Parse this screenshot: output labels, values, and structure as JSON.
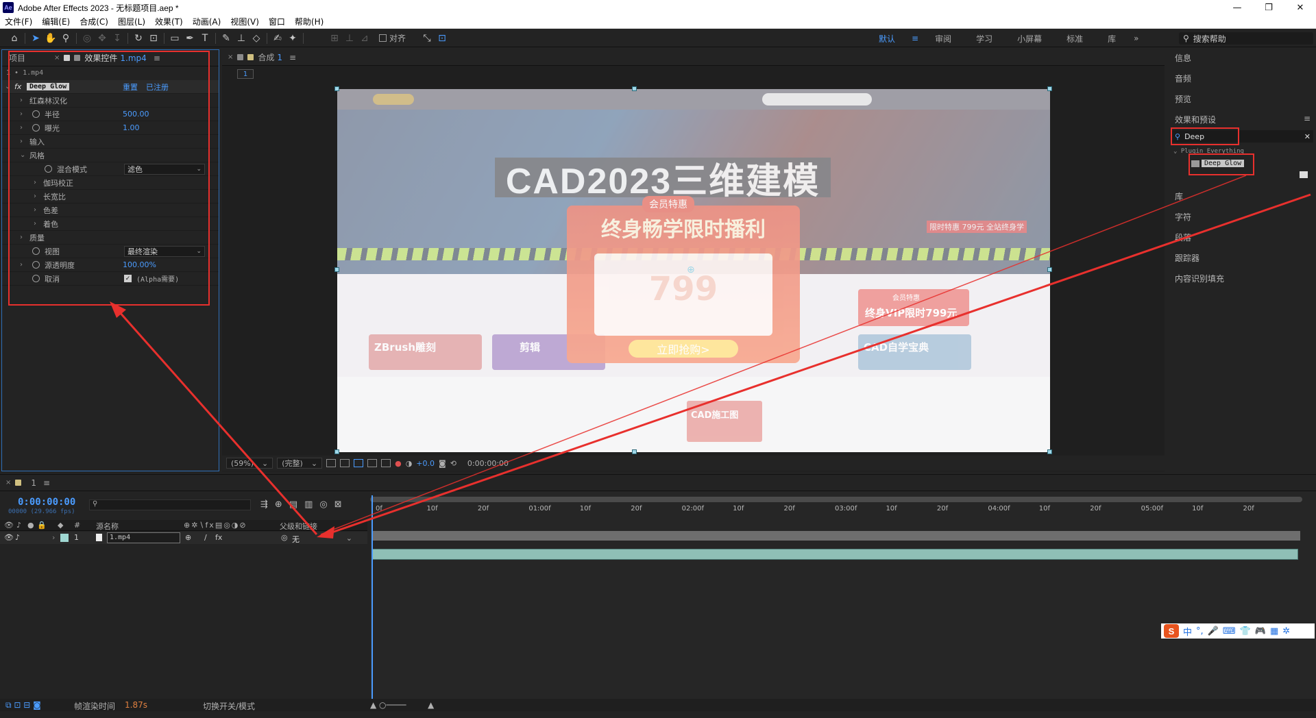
{
  "window": {
    "title": "Adobe After Effects 2023 - 无标题项目.aep *",
    "logo": "Ae",
    "controls": [
      "—",
      "❐",
      "✕"
    ]
  },
  "menu": [
    "文件(F)",
    "编辑(E)",
    "合成(C)",
    "图层(L)",
    "效果(T)",
    "动画(A)",
    "视图(V)",
    "窗口",
    "帮助(H)"
  ],
  "toolbar": {
    "snap_label": "对齐",
    "workspaces": [
      "默认",
      "审阅",
      "学习",
      "小屏幕",
      "标准",
      "库"
    ],
    "active_workspace": "默认",
    "more": "»",
    "search_help": "搜索帮助"
  },
  "project_panel": {
    "tab_project": "项目",
    "tab_effects": "效果控件",
    "tab_effects_file": "1.mp4",
    "breadcrumb": "1 • 1.mp4"
  },
  "effect": {
    "fx_symbol": "fx",
    "name": "Deep Glow",
    "reset": "重置",
    "registered": "已注册",
    "rows": [
      {
        "label": "红森林汉化",
        "kind": "twirl"
      },
      {
        "label": "半径",
        "kind": "stopwatch",
        "value": "500.00"
      },
      {
        "label": "曝光",
        "kind": "stopwatch",
        "value": "1.00"
      },
      {
        "label": "输入",
        "kind": "twirl"
      },
      {
        "label": "风格",
        "kind": "open"
      },
      {
        "label": "混合模式",
        "kind": "dropdown",
        "value": "滤色"
      },
      {
        "label": "伽玛校正",
        "kind": "sub"
      },
      {
        "label": "长宽比",
        "kind": "sub"
      },
      {
        "label": "色差",
        "kind": "sub"
      },
      {
        "label": "着色",
        "kind": "sub"
      },
      {
        "label": "质量",
        "kind": "twirl"
      },
      {
        "label": "视图",
        "kind": "dropdown",
        "value": "最终渲染"
      },
      {
        "label": "源透明度",
        "kind": "stopwatch",
        "value": "100.00%"
      },
      {
        "label": "取消",
        "kind": "checkbox",
        "value": "(Alpha需要)"
      }
    ]
  },
  "composition": {
    "tab_label": "合成",
    "comp_name": "1",
    "flow_label": "1",
    "preview": {
      "banner_title": "CAD2023三维建模",
      "popup_badge": "会员特惠",
      "popup_title": "终身畅学限时播利",
      "popup_price": "799",
      "popup_button": "立即抢购>",
      "promo_badge": "会员特惠",
      "promo_text": "终身VIP限时799元",
      "limited_offer": "限时特惠 799元 全站终身学",
      "cards": [
        "ZBrush雕刻",
        "剪辑",
        "CAD自学宝典"
      ],
      "lower_card": "CAD施工图"
    },
    "footer": {
      "zoom": "(59%)",
      "resolution": "(完整)",
      "exposure": "+0.0",
      "timecode": "0:00:00:00"
    }
  },
  "right_panel": {
    "items_top": [
      "信息",
      "音频",
      "预览"
    ],
    "effects_presets": "效果和预设",
    "search_value": "Deep",
    "plugin_category": "Plugin Everything",
    "result": "Deep Glow",
    "items_bottom": [
      "库",
      "字符",
      "段落",
      "跟踪器",
      "内容识别填充"
    ]
  },
  "timeline": {
    "tab": "1",
    "timecode": "0:00:00:00",
    "framecode": "00000 (29.966 fps)",
    "columns": {
      "num": "#",
      "source": "源名称",
      "parent": "父级和链接"
    },
    "layer": {
      "index": "1",
      "source": "1.mp4",
      "parent": "无"
    },
    "ticks": [
      "0f",
      "10f",
      "20f",
      "01:00f",
      "10f",
      "20f",
      "02:00f",
      "10f",
      "20f",
      "03:00f",
      "10f",
      "20f",
      "04:00f",
      "10f",
      "20f",
      "05:00f",
      "10f",
      "20f"
    ],
    "footer": {
      "render_label": "帧渲染时间",
      "render_value": "1.87s",
      "toggle": "切换开关/模式"
    }
  },
  "ime": {
    "logo": "S",
    "lang": "中",
    "punct": "°,"
  },
  "colors": {
    "accent": "#4b9cff",
    "annotation": "#e8302d",
    "clip": "#8fbfb6"
  }
}
